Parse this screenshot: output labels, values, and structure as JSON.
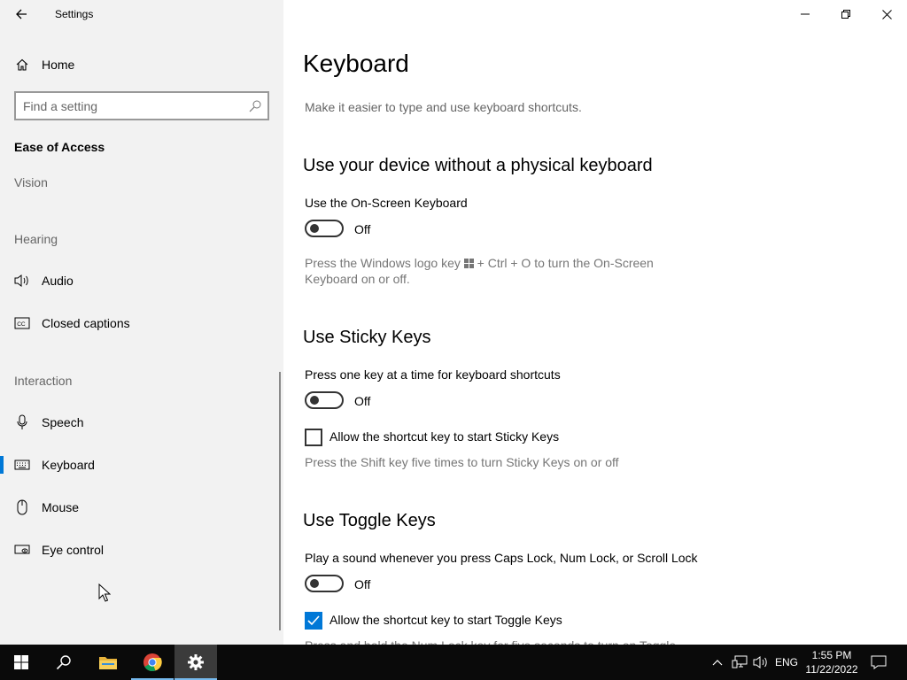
{
  "app": {
    "title": "Settings"
  },
  "sidebar": {
    "home_label": "Home",
    "search_placeholder": "Find a setting",
    "category": "Ease of Access",
    "groups": {
      "vision": "Vision",
      "hearing": "Hearing",
      "interaction": "Interaction"
    },
    "items": [
      {
        "label": "Audio",
        "icon": "speaker-icon"
      },
      {
        "label": "Closed captions",
        "icon": "closed-captions-icon"
      },
      {
        "label": "Speech",
        "icon": "microphone-icon"
      },
      {
        "label": "Keyboard",
        "icon": "keyboard-icon",
        "selected": true
      },
      {
        "label": "Mouse",
        "icon": "mouse-icon"
      },
      {
        "label": "Eye control",
        "icon": "eye-control-icon"
      }
    ]
  },
  "main": {
    "title": "Keyboard",
    "description": "Make it easier to type and use keyboard shortcuts.",
    "sections": {
      "osk": {
        "title": "Use your device without a physical keyboard",
        "toggle_label": "Use the On-Screen Keyboard",
        "toggle_state": "Off",
        "help_before": "Press the Windows logo key",
        "help_after": "+ Ctrl + O to turn the On-Screen Keyboard on or off."
      },
      "sticky": {
        "title": "Use Sticky Keys",
        "toggle_label": "Press one key at a time for keyboard shortcuts",
        "toggle_state": "Off",
        "checkbox_label": "Allow the shortcut key to start Sticky Keys",
        "checkbox_checked": false,
        "help": "Press the Shift key five times to turn Sticky Keys on or off"
      },
      "toggle_keys": {
        "title": "Use Toggle Keys",
        "toggle_label": "Play a sound whenever you press Caps Lock, Num Lock, or Scroll Lock",
        "toggle_state": "Off",
        "checkbox_label": "Allow the shortcut key to start Toggle Keys",
        "checkbox_checked": true,
        "help_partial": "Press and hold the Num Lock key for five seconds to turn on Toggle"
      }
    }
  },
  "taskbar": {
    "apps": [
      "start-icon",
      "search-icon",
      "file-explorer-icon",
      "chrome-icon",
      "settings-icon"
    ],
    "language": "ENG",
    "time": "1:55 PM",
    "date": "11/22/2022"
  },
  "colors": {
    "accent": "#0078d7",
    "sidebar_bg": "#f2f2f2",
    "taskbar_bg": "#0a0a0a"
  }
}
